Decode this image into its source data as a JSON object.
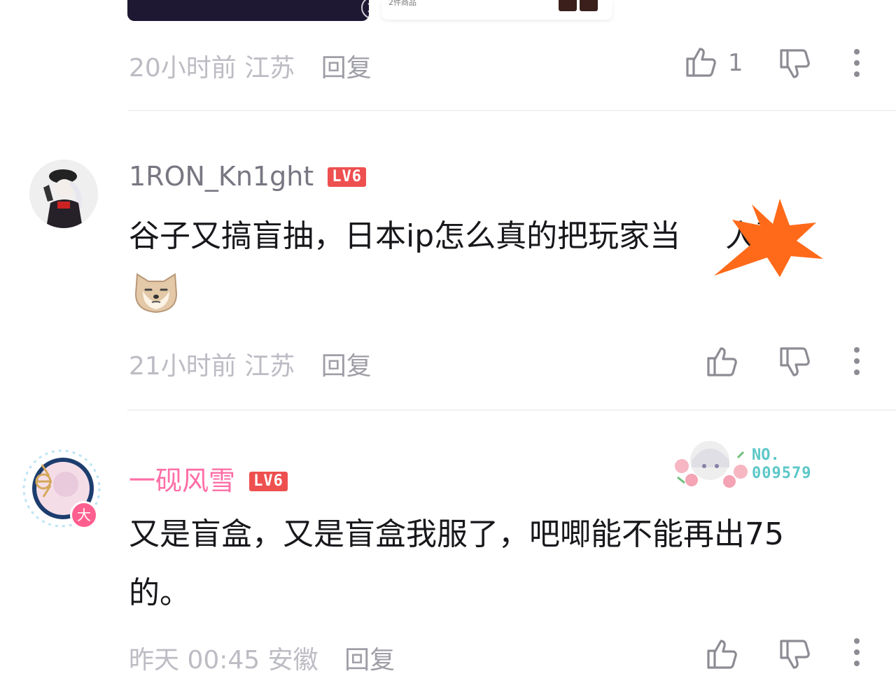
{
  "top": {
    "goods_text": "2件商品"
  },
  "comments": [
    {
      "meta_time": "20小时前",
      "meta_location": "江苏",
      "reply_label": "回复",
      "like_count": "1"
    },
    {
      "username": "1RON_Kn1ght",
      "level": "LV6",
      "text_line1": "谷子又搞盲抽，日本ip怎么真的把玩家当",
      "text_line1_tail": "人整",
      "meta_time": "21小时前",
      "meta_location": "江苏",
      "reply_label": "回复"
    },
    {
      "username": "一砚风雪",
      "level": "LV6",
      "fan_badge_no": "NO.",
      "fan_badge_number": "009579",
      "avatar_tag": "大",
      "text_line1": "又是盲盒，又是盲盒我服了，吧唧能不能再出75",
      "text_line2": "的。",
      "meta_time": "昨天 00:45",
      "meta_location": "安徽",
      "reply_label": "回复"
    }
  ],
  "colors": {
    "accent_pink": "#ff6ea6",
    "level_red": "#ee5050",
    "meta_gray": "#bcbcc4",
    "sticker_orange": "#ff6a1a"
  },
  "icons": [
    "close-icon",
    "thumb-up-icon",
    "thumb-down-icon",
    "more-icon",
    "shiba-emoji-icon",
    "censor-star-icon"
  ]
}
